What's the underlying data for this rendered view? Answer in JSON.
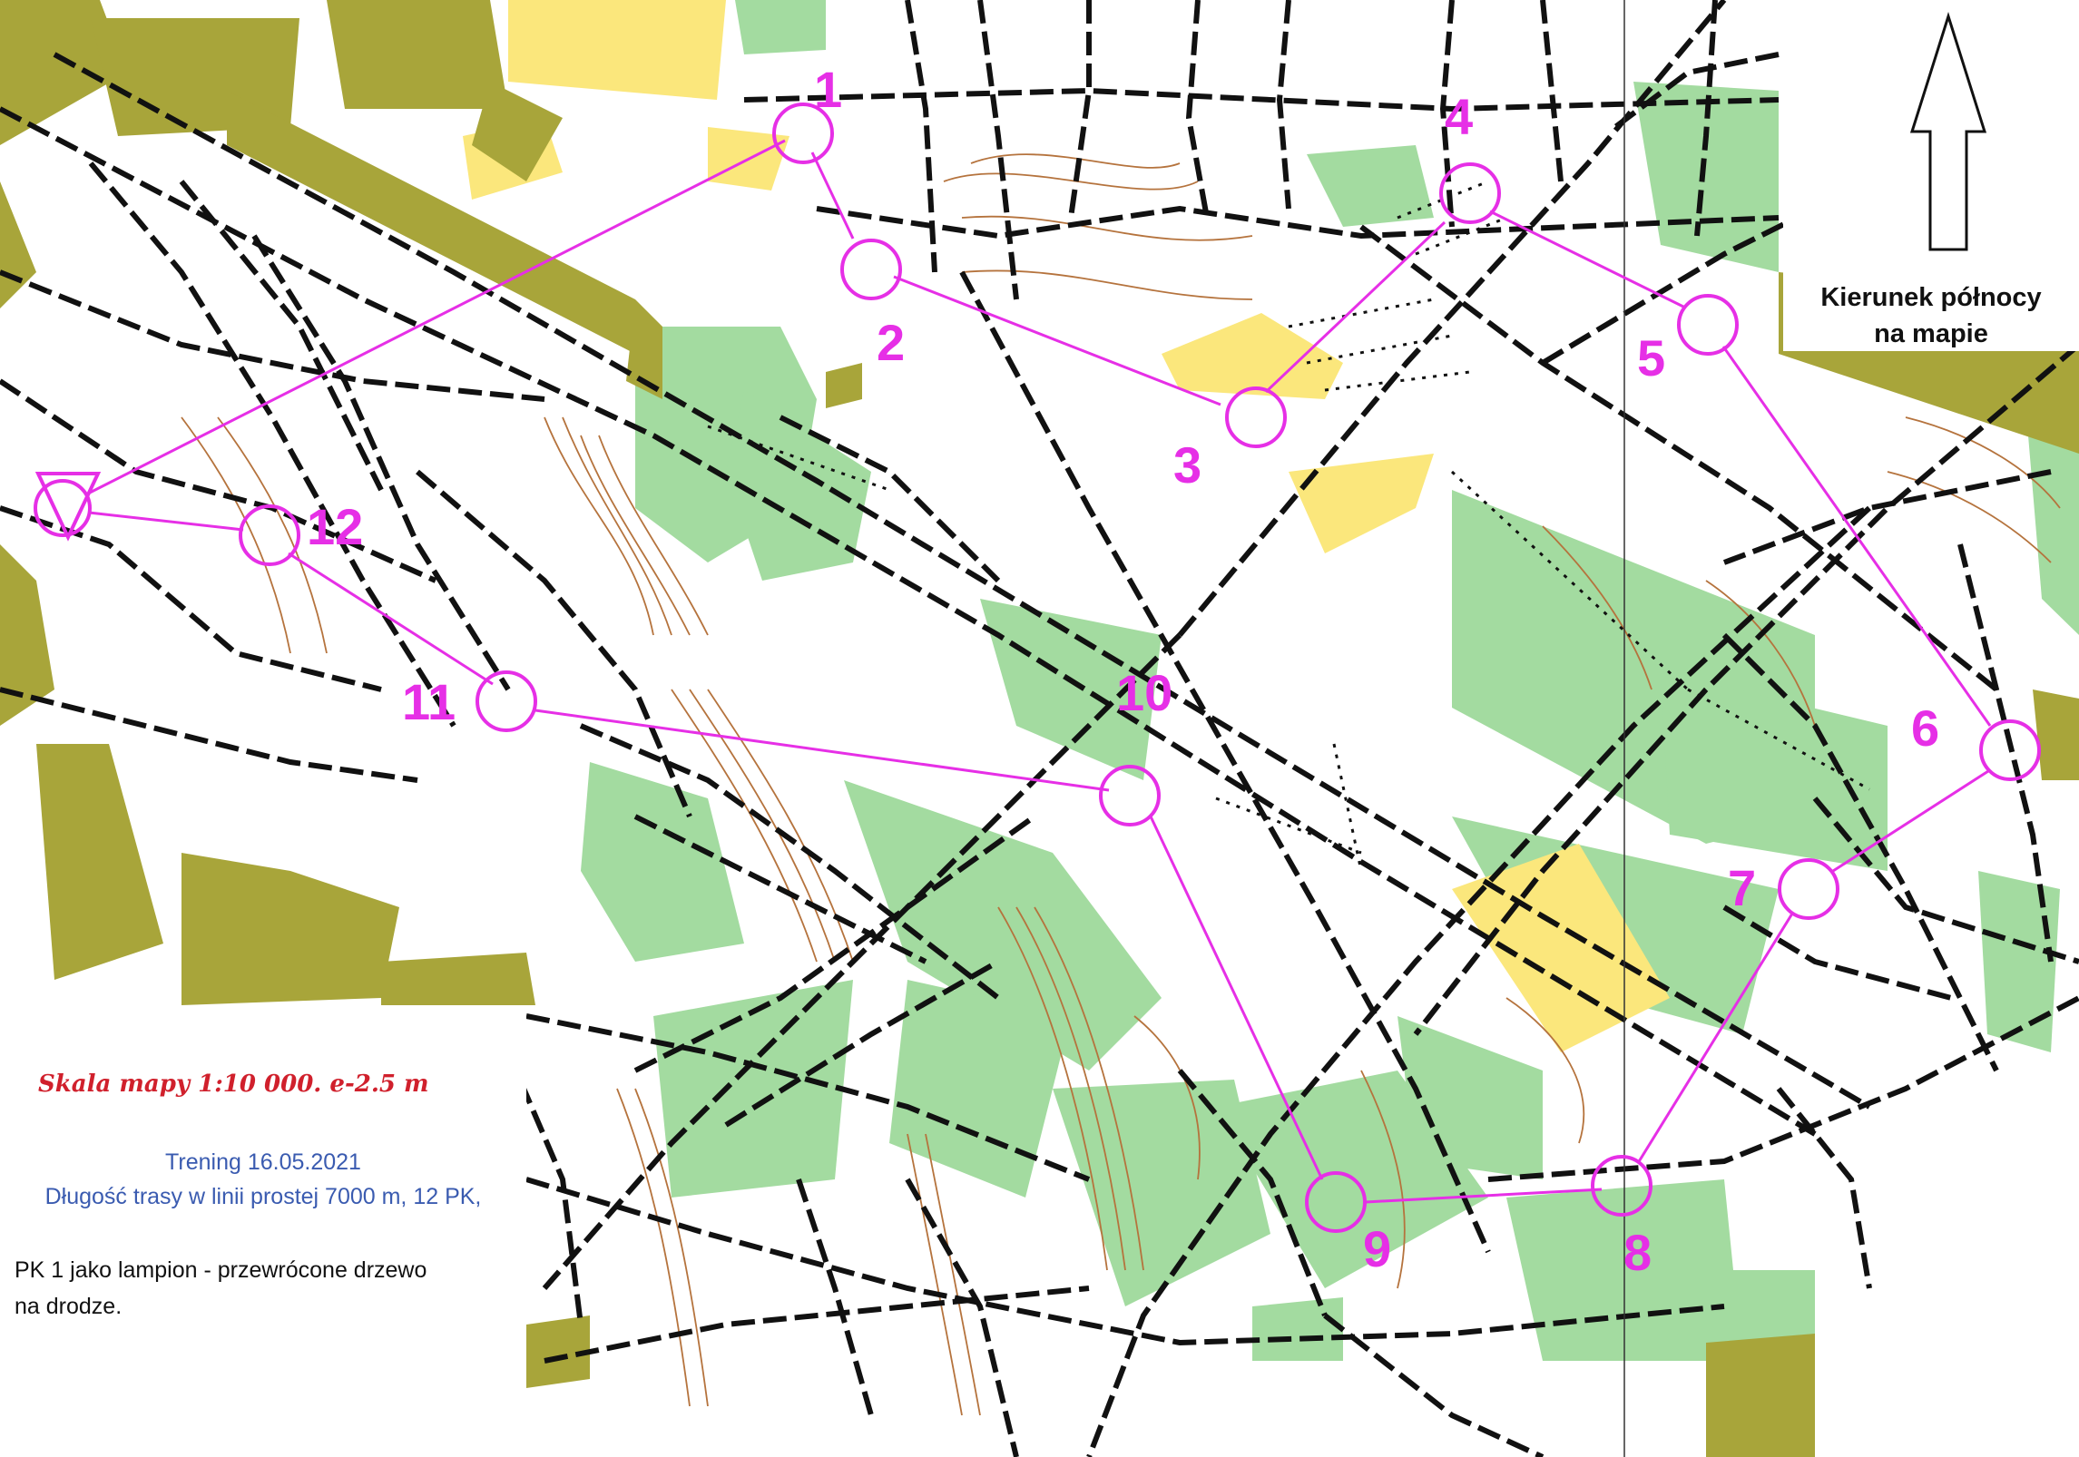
{
  "map": {
    "colors": {
      "open": "#ffffff",
      "forest_green": "#a3dba0",
      "rough_yellow": "#fbe77c",
      "olive_private": "#a8a53a",
      "track_black": "#111111",
      "contour_brown": "#b5733d",
      "course_magenta": "#e62fe6"
    },
    "icons": [
      "north-arrow-icon",
      "start-triangle-icon",
      "control-circle-icon"
    ]
  },
  "course": {
    "controls": [
      {
        "label": "1"
      },
      {
        "label": "2"
      },
      {
        "label": "3"
      },
      {
        "label": "4"
      },
      {
        "label": "5"
      },
      {
        "label": "6"
      },
      {
        "label": "7"
      },
      {
        "label": "8"
      },
      {
        "label": "9"
      },
      {
        "label": "10"
      },
      {
        "label": "11"
      },
      {
        "label": "12"
      }
    ]
  },
  "north": {
    "line1": "Kierunek północy",
    "line2": "na mapie"
  },
  "legend": {
    "scale": "Skala mapy 1:10 000.  e-2.5 m",
    "title": "Trening 16.05.2021",
    "length": "Długość trasy w linii prostej 7000 m, 12 PK,",
    "note_line1": "PK 1 jako lampion - przewrócone drzewo",
    "note_line2": "na drodze."
  }
}
